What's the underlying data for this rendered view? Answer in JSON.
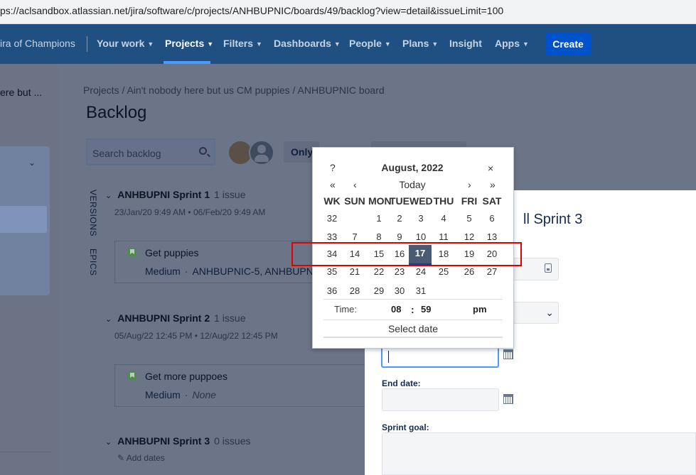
{
  "browser": {
    "url": "ps://aclsandbox.atlassian.net/jira/software/c/projects/ANHBUPNIC/boards/49/backlog?view=detail&issueLimit=100"
  },
  "nav": {
    "brand": "ira of Champions",
    "items": [
      "Your work",
      "Projects",
      "Filters",
      "Dashboards",
      "People",
      "Plans",
      "Insight",
      "Apps"
    ],
    "create": "Create"
  },
  "sidebar": {
    "project_name": "ere but ..."
  },
  "breadcrumb": "Projects  /  Ain't nobody here but us CM puppies  /  ANHBUPNIC board",
  "page_title": "Backlog",
  "search": {
    "placeholder": "Search backlog"
  },
  "filters": {
    "only": "Only"
  },
  "side_labels": {
    "versions": "VERSIONS",
    "epics": "EPICS"
  },
  "sprints": [
    {
      "name": "ANHBUPNI Sprint 1",
      "count": "1 issue",
      "dates": "23/Jan/20 9:49 AM • 06/Feb/20 9:49 AM",
      "issues": [
        {
          "title": "Get puppies",
          "priority": "Medium",
          "keys": "ANHBUPNIC-5, ANHBUPN"
        }
      ]
    },
    {
      "name": "ANHBUPNI Sprint 2",
      "count": "1 issue",
      "dates": "05/Aug/22 12:45 PM • 12/Aug/22 12:45 PM",
      "issues": [
        {
          "title": "Get more puppoes",
          "priority": "Medium",
          "keys": "None"
        }
      ]
    },
    {
      "name": "ANHBUPNI Sprint 3",
      "count": "0 issues",
      "dates": "",
      "add_dates": "Add dates"
    }
  ],
  "modal": {
    "title_fragment": "ll Sprint 3",
    "end_label": "End date:",
    "goal_label": "Sprint goal:"
  },
  "calendar": {
    "help": "?",
    "title": "August, 2022",
    "close": "×",
    "nav": {
      "prev_year": "«",
      "prev_month": "‹",
      "today": "Today",
      "next_month": "›",
      "next_year": "»"
    },
    "headers": [
      "WK",
      "SUN",
      "MON",
      "TUE",
      "WED",
      "THU",
      "FRI",
      "SAT"
    ],
    "weeks": [
      {
        "wk": "32",
        "days": [
          "",
          "1",
          "2",
          "3",
          "4",
          "5",
          "6"
        ]
      },
      {
        "wk": "33",
        "days": [
          "7",
          "8",
          "9",
          "10",
          "11",
          "12",
          "13"
        ]
      },
      {
        "wk": "34",
        "days": [
          "14",
          "15",
          "16",
          "17",
          "18",
          "19",
          "20"
        ]
      },
      {
        "wk": "35",
        "days": [
          "21",
          "22",
          "23",
          "24",
          "25",
          "26",
          "27"
        ]
      },
      {
        "wk": "36",
        "days": [
          "28",
          "29",
          "30",
          "31",
          "",
          "",
          ""
        ]
      }
    ],
    "selected_day": "17",
    "time": {
      "label": "Time:",
      "hour": "08",
      "sep": ":",
      "minute": "59",
      "ampm": "pm"
    },
    "select_date": "Select date"
  }
}
